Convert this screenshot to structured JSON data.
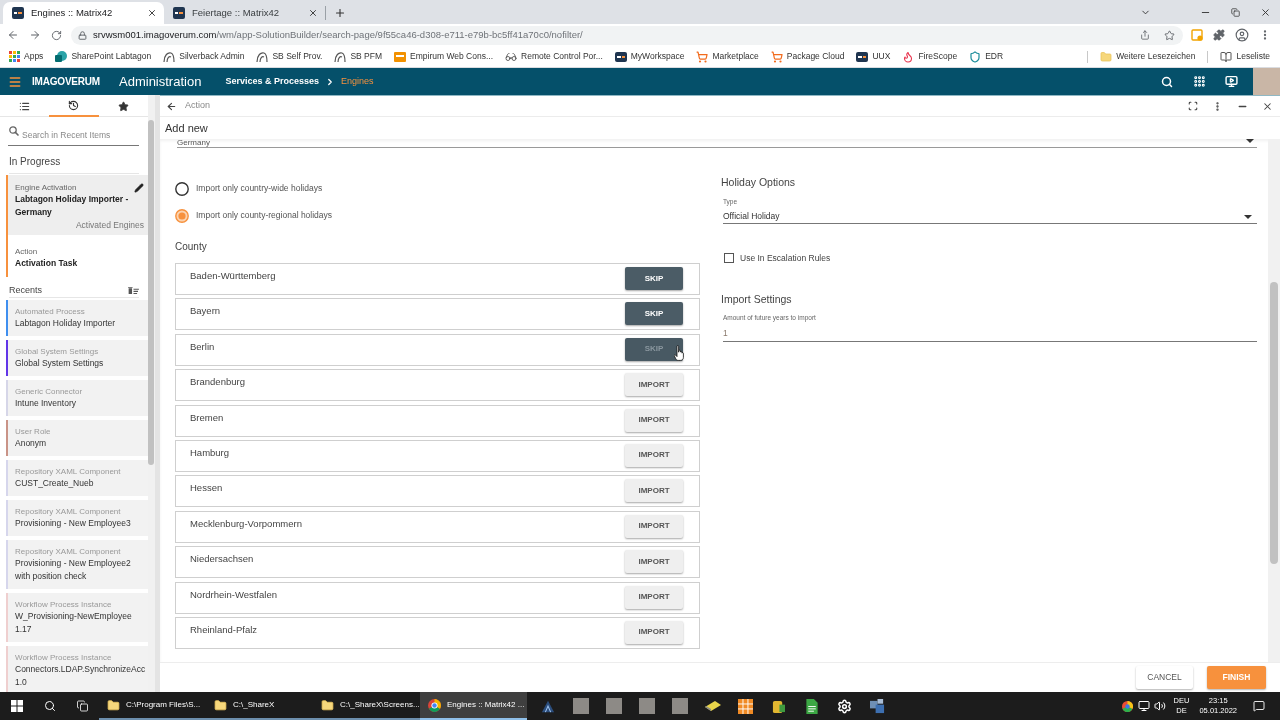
{
  "browser": {
    "tabs": [
      {
        "title": "Engines :: Matrix42",
        "selected": true
      },
      {
        "title": "Feiertage :: Matrix42",
        "selected": false
      }
    ],
    "url": {
      "host": "srvwsm001.imagoverum.com",
      "path": "/wm/app-SolutionBuilder/search-page/9f55ca46-d308-e711-e79b-bc5ff41a70c0/nofilter/"
    },
    "bookmarks": [
      {
        "label": "Apps",
        "kind": "apps"
      },
      {
        "label": "SharePoint Labtagon",
        "kind": "sharepoint"
      },
      {
        "label": "Silverback Admin",
        "kind": "silverback"
      },
      {
        "label": "SB Self Prov.",
        "kind": "silverback"
      },
      {
        "label": "SB PFM",
        "kind": "silverback"
      },
      {
        "label": "Empirum Web Cons...",
        "kind": "empirum"
      },
      {
        "label": "Remote Control Por...",
        "kind": "remote"
      },
      {
        "label": "MyWorkspace",
        "kind": "matrix"
      },
      {
        "label": "Marketplace",
        "kind": "cart"
      },
      {
        "label": "Package Cloud",
        "kind": "cart"
      },
      {
        "label": "UUX",
        "kind": "matrix"
      },
      {
        "label": "FireScope",
        "kind": "flame"
      },
      {
        "label": "EDR",
        "kind": "shield"
      }
    ],
    "bookmarks_right": [
      {
        "label": "Weitere Lesezeichen",
        "kind": "folder"
      },
      {
        "label": "Leseliste",
        "kind": "reading"
      }
    ]
  },
  "app_header": {
    "logo": "IMAGOVERUM",
    "title": "Administration",
    "breadcrumb": [
      {
        "label": "Services & Processes",
        "current": false
      },
      {
        "label": "Engines",
        "current": true
      }
    ]
  },
  "sidebar": {
    "tabs": [
      {
        "kind": "list",
        "selected": false
      },
      {
        "kind": "history",
        "selected": true
      },
      {
        "kind": "favorites",
        "selected": false
      }
    ],
    "search": {
      "placeholder": "Search in Recent Items"
    },
    "in_progress": {
      "title": "In Progress",
      "items": [
        {
          "type": "Engine Activation",
          "title": "Labtagon Holiday Importer - Germany",
          "context": "Activated Engines",
          "selected": true,
          "color": "#f7913d"
        },
        {
          "type": "Action",
          "title": "Activation Task",
          "selected": false,
          "color": "#f7913d"
        }
      ]
    },
    "recents": {
      "title": "Recents",
      "items": [
        {
          "type": "Automated Process",
          "title": "Labtagon Holiday Importer",
          "color": "#3f8fef"
        },
        {
          "type": "Global System Settings",
          "title": "Global System Settings",
          "color": "#6236e8"
        },
        {
          "type": "Generic Connector",
          "title": "Intune Inventory",
          "color": "#d6d6e8"
        },
        {
          "type": "User Role",
          "title": "Anonym",
          "color": "#c99387"
        },
        {
          "type": "Repository XAML Component",
          "title": "CUST_Create_Nueb",
          "color": "#d6d6ec"
        },
        {
          "type": "Repository XAML Component",
          "title": "Provisioning - New Employee3",
          "color": "#d6d6ec"
        },
        {
          "type": "Repository XAML Component",
          "title": "Provisioning - New Employee2 with position check",
          "color": "#d6d6ec"
        },
        {
          "type": "Workflow Process Instance",
          "title": "W_Provisioning-NewEmployee 1.17",
          "color": "#efcfcf"
        },
        {
          "type": "Workflow Process Instance",
          "title": "Connectors.LDAP.SynchronizeAcc 1.0",
          "color": "#efcfcf"
        }
      ]
    }
  },
  "panel": {
    "title": "Action",
    "heading": "Add new",
    "country": {
      "value": "Germany"
    },
    "scope_options": [
      {
        "label": "Import only country-wide holidays",
        "selected": false
      },
      {
        "label": "Import only county-regional holidays",
        "selected": true
      }
    ],
    "county": {
      "label": "County",
      "items": [
        {
          "name": "Baden-Württemberg",
          "action": "SKIP",
          "skipped": true,
          "hovered": false
        },
        {
          "name": "Bayern",
          "action": "SKIP",
          "skipped": true,
          "hovered": false
        },
        {
          "name": "Berlin",
          "action": "SKIP",
          "skipped": true,
          "hovered": true
        },
        {
          "name": "Brandenburg",
          "action": "IMPORT",
          "skipped": false,
          "hovered": false
        },
        {
          "name": "Bremen",
          "action": "IMPORT",
          "skipped": false,
          "hovered": false
        },
        {
          "name": "Hamburg",
          "action": "IMPORT",
          "skipped": false,
          "hovered": false
        },
        {
          "name": "Hessen",
          "action": "IMPORT",
          "skipped": false,
          "hovered": false
        },
        {
          "name": "Mecklenburg-Vorpommern",
          "action": "IMPORT",
          "skipped": false,
          "hovered": false
        },
        {
          "name": "Niedersachsen",
          "action": "IMPORT",
          "skipped": false,
          "hovered": false
        },
        {
          "name": "Nordrhein-Westfalen",
          "action": "IMPORT",
          "skipped": false,
          "hovered": false
        },
        {
          "name": "Rheinland-Pfalz",
          "action": "IMPORT",
          "skipped": false,
          "hovered": false
        }
      ]
    },
    "holiday_options": {
      "title": "Holiday Options",
      "type": {
        "label": "Type",
        "value": "Official Holiday"
      },
      "escalation": {
        "label": "Use In Escalation Rules",
        "checked": false
      }
    },
    "import_settings": {
      "title": "Import Settings",
      "years": {
        "label": "Amount of future years to import",
        "value": "1"
      }
    },
    "buttons": [
      {
        "label": "CANCEL",
        "kind": "secondary"
      },
      {
        "label": "FINISH",
        "kind": "primary"
      }
    ]
  },
  "taskbar": {
    "windows": [
      {
        "label": "C:\\Program Files\\S...",
        "kind": "folder",
        "selected": false
      },
      {
        "label": "C:\\_ShareX",
        "kind": "folder",
        "selected": false
      },
      {
        "label": "C:\\_ShareX\\Screens...",
        "kind": "folder",
        "selected": false
      },
      {
        "label": "Engines :: Matrix42 ...",
        "kind": "browser",
        "selected": true
      }
    ],
    "input_language": {
      "primary": "DEU",
      "secondary": "DE"
    },
    "clock": {
      "time": "23:15",
      "date": "05.01.2022"
    }
  }
}
